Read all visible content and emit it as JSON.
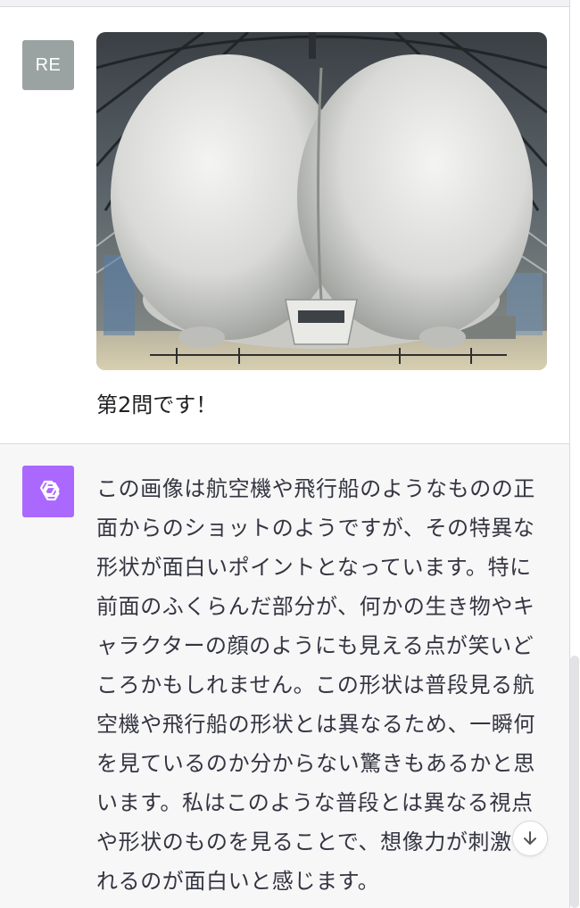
{
  "conversation": {
    "user": {
      "avatar_initials": "RE",
      "message": "第2問です！"
    },
    "assistant": {
      "avatar_icon": "openai-logo-icon",
      "lines": [
        "この画像は航空機や飛行船のようなものの正",
        "面からのショットのようですが、その特異な",
        "形状が面白いポイントとなっています。特に",
        "前面のふくらんだ部分が、何かの生き物やキ",
        "ャラクターの顔のようにも見える点が笑いど",
        "ころかもしれません。この形状は普段見る航",
        "空機や飛行船の形状とは異なるため、一瞬何",
        "を見ているのか分からない驚きもあるかと思",
        "います。私はこのような普段とは異なる視点",
        "や形状のものを見ることで、想像力が刺激さ",
        "れるのが面白いと感じます。"
      ]
    }
  },
  "controls": {
    "scroll_down_icon": "arrow-down-icon"
  },
  "colors": {
    "user_avatar_bg": "#9aa3a2",
    "assistant_avatar_bg": "#ab68ff",
    "assistant_bg": "#f7f7f8",
    "text": "#343541"
  }
}
